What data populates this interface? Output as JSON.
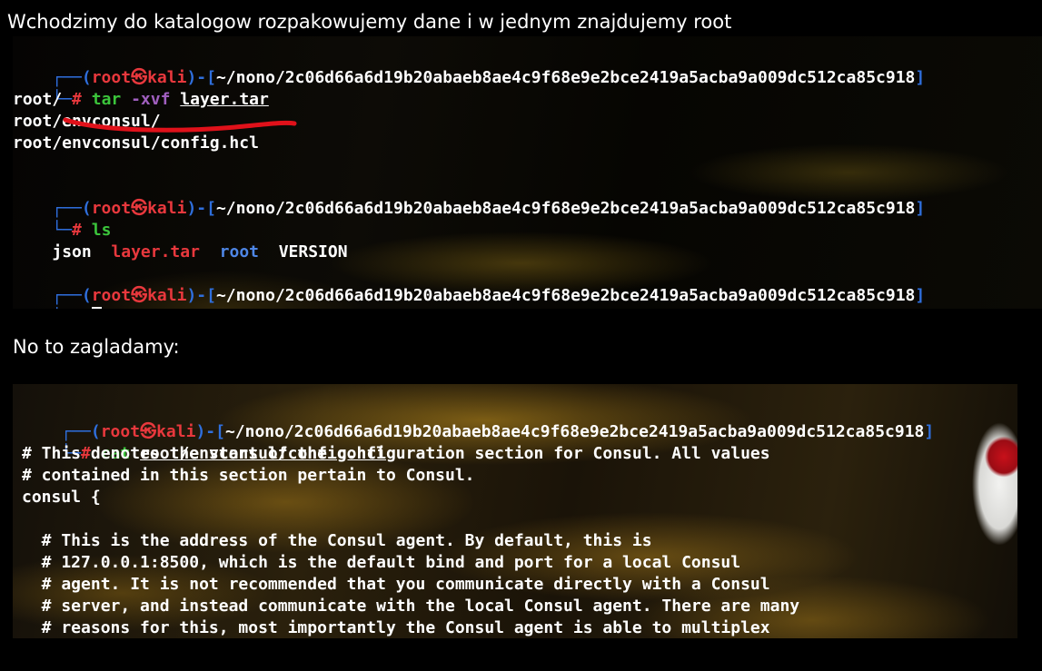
{
  "captions": {
    "top": "Wchodzimy do katalogow rozpakowujemy dane i w jednym znajdujemy root",
    "middle": "No to zagladamy:"
  },
  "prompt": {
    "corner_top": "┌──(",
    "user": "root",
    "skull": "㉿",
    "host": "kali",
    "sep": ")-[",
    "cwd": "~/nono/2c06d66a6d19b20abaeb8ae4c9f68e9e2bce2419a5acba9a009dc512ca85c918",
    "close": "]",
    "corner_bottom": "└─",
    "hash": "#"
  },
  "terminal1": {
    "cmd1": {
      "name": "tar",
      "opt": "-xvf",
      "arg": "layer.tar"
    },
    "out1": [
      "root/",
      "root/envconsul/",
      "root/envconsul/config.hcl"
    ],
    "cmd2": {
      "name": "ls"
    },
    "ls_items": [
      "json",
      "layer.tar",
      "root",
      "VERSION"
    ]
  },
  "terminal2": {
    "cmd": {
      "name": "cat",
      "arg": "root/envconsul/config.hcl"
    },
    "lines": [
      "# This denotes the start of the configuration section for Consul. All values",
      "# contained in this section pertain to Consul.",
      "consul {",
      "",
      "  # This is the address of the Consul agent. By default, this is",
      "  # 127.0.0.1:8500, which is the default bind and port for a local Consul",
      "  # agent. It is not recommended that you communicate directly with a Consul",
      "  # server, and instead communicate with the local Consul agent. There are many",
      "  # reasons for this, most importantly the Consul agent is able to multiplex"
    ]
  },
  "colors": {
    "prompt_box": "#2f6fdd",
    "user_host": "#e8383d",
    "command": "#3bc43b",
    "option": "#a05fbf",
    "directory": "#4e86e6",
    "archive": "#e8383d",
    "annotation": "#e0111a"
  }
}
